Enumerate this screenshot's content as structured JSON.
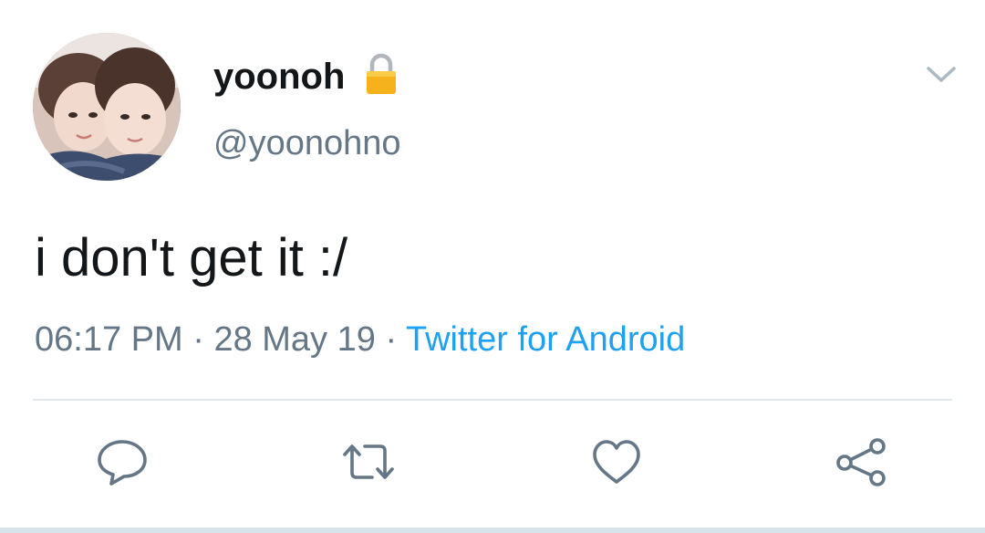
{
  "tweet": {
    "display_name": "yoonoh",
    "handle": "@yoonohno",
    "text": "i don't get it :/",
    "time": "06:17 PM",
    "separator": "·",
    "date": "28 May 19",
    "source": "Twitter for Android"
  },
  "icons": {
    "lock": "lock-icon",
    "caret": "chevron-down-icon",
    "reply": "reply-icon",
    "retweet": "retweet-icon",
    "like": "heart-icon",
    "share": "share-icon"
  },
  "colors": {
    "text_primary": "#14171a",
    "text_secondary": "#657786",
    "link": "#1da1f2",
    "divider": "#e1e8ed",
    "icon": "#657786"
  }
}
